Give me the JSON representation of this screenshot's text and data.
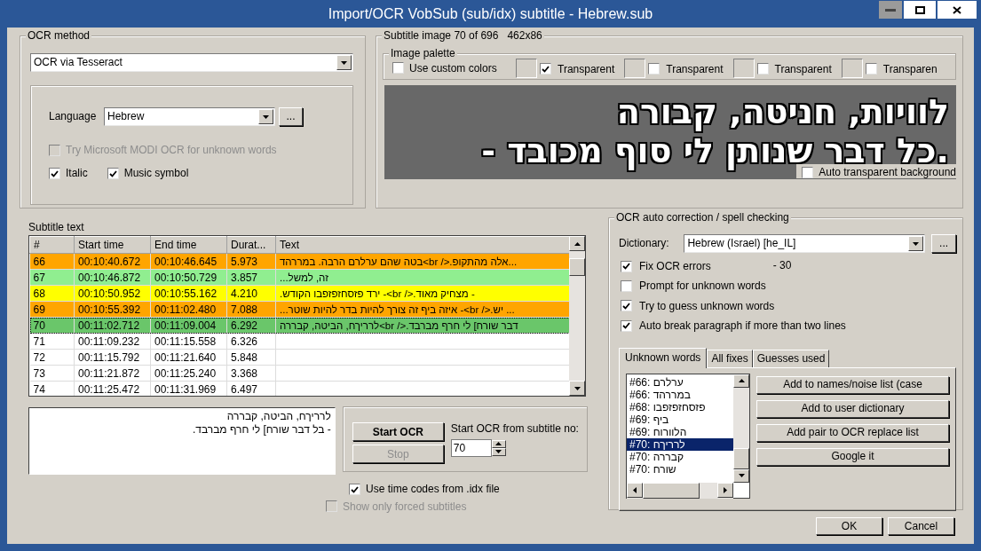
{
  "window": {
    "title": "Import/OCR VobSub (sub/idx) subtitle - Hebrew.sub"
  },
  "ocr_method": {
    "title": "OCR method",
    "method": "OCR via Tesseract",
    "language_label": "Language",
    "language": "Hebrew",
    "more_button": "...",
    "options": [
      {
        "label": "Try Microsoft MODI OCR for unknown words",
        "checked": false,
        "disabled": true
      },
      {
        "label": "Italic",
        "checked": true,
        "disabled": false
      },
      {
        "label": "Music symbol",
        "checked": true,
        "disabled": false
      }
    ]
  },
  "subtitle_image": {
    "title": "Subtitle image 70 of 696",
    "size": "462x86",
    "palette": {
      "title": "Image palette",
      "use_custom_colors": {
        "label": "Use custom colors",
        "checked": false
      },
      "entries": [
        {
          "label": "Transparent",
          "checked": true
        },
        {
          "label": "Transparent",
          "checked": false
        },
        {
          "label": "Transparent",
          "checked": false
        },
        {
          "label": "Transparen",
          "checked": false
        }
      ]
    },
    "lines": [
      "לוויות, חניטה, קבורה",
      ".כל דבר שנותן לי סוף מכובד -"
    ],
    "auto_transparent": {
      "label": "Auto transparent background",
      "checked": false
    }
  },
  "subtitle_text": {
    "title": "Subtitle text",
    "columns": [
      "#",
      "Start time",
      "End time",
      "Durat...",
      "Text"
    ],
    "rows": [
      {
        "number": "66",
        "start": "00:10:40.672",
        "end": "00:10:46.645",
        "duration": "5.973",
        "text": "...אלה מהתקופ.</ br>בטה שהם ערלרם הרבה. במררהד",
        "color": "#ffa500",
        "selected": false
      },
      {
        "number": "67",
        "start": "00:10:46.872",
        "end": "00:10:50.729",
        "duration": "3.857",
        "text": "זה, למשל...",
        "color": "#90ee90",
        "selected": false
      },
      {
        "number": "68",
        "start": "00:10:50.952",
        "end": "00:10:55.162",
        "duration": "4.210",
        "text": "- מצחיק מאוד.</ br>- ירד פזסחזפזפבו הקודש.",
        "color": "#ffff00",
        "selected": false
      },
      {
        "number": "69",
        "start": "00:10:55.392",
        "end": "00:11:02.480",
        "duration": "7.088",
        "text": "... יש.</ br>- איזה ביף זה צורך להיות בדר להיות שוטר...",
        "color": "#ffa500",
        "selected": false
      },
      {
        "number": "70",
        "start": "00:11:02.712",
        "end": "00:11:09.004",
        "duration": "6.292",
        "text": "דבר שורח] לי חרף מברבד.</ br>לרריךח, הביטה, קבררה",
        "color": "#6ac66a",
        "selected": true
      },
      {
        "number": "71",
        "start": "00:11:09.232",
        "end": "00:11:15.558",
        "duration": "6.326",
        "color": "#ffffff",
        "selected": false
      },
      {
        "number": "72",
        "start": "00:11:15.792",
        "end": "00:11:21.640",
        "duration": "5.848",
        "color": "#ffffff",
        "selected": false
      },
      {
        "number": "73",
        "start": "00:11:21.872",
        "end": "00:11:25.240",
        "duration": "3.368",
        "color": "#ffffff",
        "selected": false
      },
      {
        "number": "74",
        "start": "00:11:25.472",
        "end": "00:11:31.969",
        "duration": "6.497",
        "color": "#ffffff",
        "selected": false
      }
    ]
  },
  "current_text": "לרריךח, הביטה, קבררה\n- בל דבר שורח] לי חרף מברבד.",
  "ocr_controls": {
    "start_button": {
      "label": "Start OCR",
      "disabled": false
    },
    "stop_button": {
      "label": "Stop",
      "disabled": true
    },
    "start_from_label": "Start OCR from subtitle no:",
    "start_from": "70"
  },
  "use_time_codes": {
    "label": "Use time codes from .idx file",
    "checked": true,
    "disabled": false
  },
  "show_forced": {
    "label": "Show only forced subtitles",
    "checked": false,
    "disabled": true
  },
  "auto_correction": {
    "title": "OCR auto correction / spell checking",
    "dictionary_label": "Dictionary:",
    "dictionary": "Hebrew (Israel) [he_IL]",
    "more_button": "...",
    "options": [
      {
        "label": "Fix OCR errors",
        "checked": true,
        "note": "- 30"
      },
      {
        "label": "Prompt for unknown words",
        "checked": false
      },
      {
        "label": "Try to guess unknown words",
        "checked": true
      },
      {
        "label": "Auto break paragraph if more than two lines",
        "checked": true
      }
    ],
    "tabs": [
      {
        "label": "Unknown words",
        "selected": true
      },
      {
        "label": "All fixes",
        "selected": false
      },
      {
        "label": "Guesses used",
        "selected": false
      }
    ],
    "unknown_words": [
      {
        "text": "#66: ערלרם",
        "selected": false
      },
      {
        "text": "#66: במררהד",
        "selected": false
      },
      {
        "text": "#68: פזסחזפזפבו",
        "selected": false
      },
      {
        "text": "#69: ביף",
        "selected": false
      },
      {
        "text": "#69: הלוורוח",
        "selected": false
      },
      {
        "text": "#70: לרריךח",
        "selected": true
      },
      {
        "text": "#70: קבררה",
        "selected": false
      },
      {
        "text": "#70: שורח",
        "selected": false
      }
    ],
    "actions": [
      "Add to names/noise list (case",
      "Add to user dictionary",
      "Add pair to OCR replace list",
      "Google it"
    ]
  },
  "buttons": [
    "OK",
    "Cancel"
  ]
}
